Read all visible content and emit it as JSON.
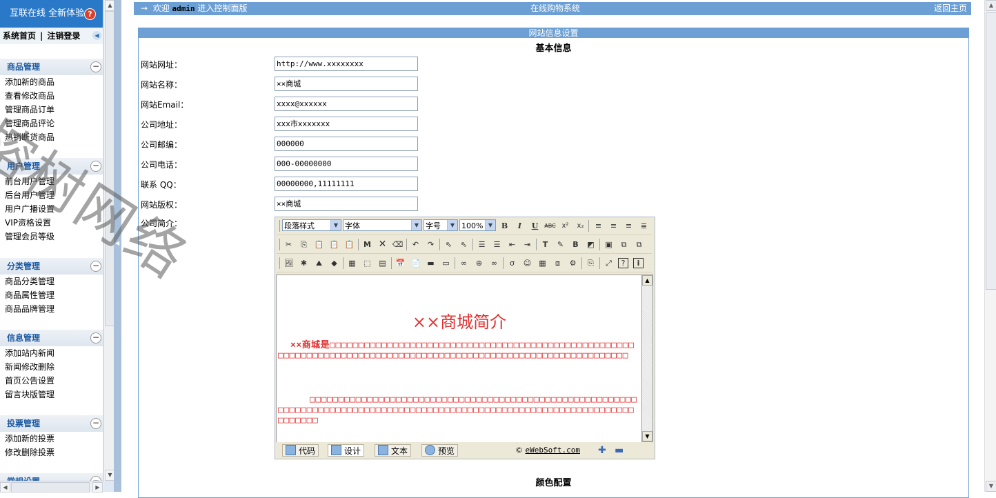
{
  "sidebar": {
    "banner": "互联在线 全新体验",
    "home_link": "系统首页",
    "separator": "|",
    "logout_link": "注销登录",
    "groups": [
      {
        "title": "商品管理",
        "items": [
          "添加新的商品",
          "查看修改商品",
          "管理商品订单",
          "管理商品评论",
          "热销断货商品"
        ]
      },
      {
        "title": "用户管理",
        "items": [
          "前台用户管理",
          "后台用户管理",
          "用户广播设置",
          "VIP资格设置",
          "管理会员等级"
        ]
      },
      {
        "title": "分类管理",
        "items": [
          "商品分类管理",
          "商品属性管理",
          "商品品牌管理"
        ]
      },
      {
        "title": "信息管理",
        "items": [
          "添加站内新闻",
          "新闻修改删除",
          "首页公告设置",
          "留言块版管理"
        ]
      },
      {
        "title": "投票管理",
        "items": [
          "添加新的投票",
          "修改删除投票"
        ]
      },
      {
        "title": "常规设置",
        "items": []
      }
    ]
  },
  "topbar": {
    "arrow": "→",
    "welcome": "欢迎",
    "user": "admin",
    "welcome_suffix": "进入控制面版",
    "system_name": "在线购物系统",
    "return_home": "返回主页"
  },
  "panel": {
    "title": "网站信息设置",
    "section_basic": "基本信息",
    "section_color": "颜色配置",
    "fields": [
      {
        "label": "网站网址：",
        "value": "http://www.xxxxxxxx"
      },
      {
        "label": "网站名称：",
        "value": "××商城"
      },
      {
        "label": "网站Email：",
        "value": "xxxx@xxxxxx"
      },
      {
        "label": "公司地址：",
        "value": "xxx市xxxxxxx"
      },
      {
        "label": "公司邮编：",
        "value": "000000"
      },
      {
        "label": "公司电话：",
        "value": "000-00000000"
      },
      {
        "label": "联系 QQ：",
        "value": "00000000,11111111"
      },
      {
        "label": "网站版权：",
        "value": "××商城"
      }
    ],
    "intro_label": "公司简介："
  },
  "editor": {
    "paragraph_style": "段落样式",
    "font": "字体",
    "font_size": "字号",
    "zoom": "100%",
    "content_title": "××商城简介",
    "content_p1": "××商城是□□□□□□□□□□□□□□□□□□□□□□□□□□□□□□□□□□□□□□□□□□□□□□□□□□□□□□□□□□□□□□□□□□□□□□□□□□□□□□□□□□□□□□□□□□□□□□□□□□□□□□□□□□□□□□□□□□",
    "content_p2": "□□□□□□□□□□□□□□□□□□□□□□□□□□□□□□□□□□□□□□□□□□□□□□□□□□□□□□□□□□□□□□□□□□□□□□□□□□□□□□□□□□□□□□□□□□□□□□□□□□□□□□□□□□□□□□□□□□□□□□□□□□□□□□",
    "tabs": [
      "代码",
      "设计",
      "文本",
      "预览"
    ],
    "active_tab": "设计",
    "copyright_symbol": "©",
    "copyright_link": "eWebSoft.com"
  },
  "watermark": "榕树网络",
  "icons": [
    "help-icon",
    "collapse-arrow-icon",
    "minus-icon",
    "bold-icon",
    "italic-icon",
    "underline-icon",
    "zoom-in-icon",
    "zoom-out-icon"
  ],
  "colors": {
    "topbar": "#6c9fd3",
    "banner": "#2a79c9",
    "group_title": "#1d5aa3",
    "editor_text": "#e03030"
  }
}
